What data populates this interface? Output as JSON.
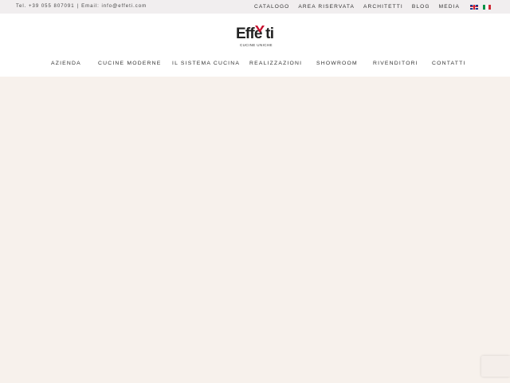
{
  "topbar": {
    "phone": "Tel. +39 055 807091",
    "separator": "|",
    "email": "Email: info@effeti.com",
    "links": [
      "CATALOGO",
      "AREA RISERVATA",
      "ARCHITETTI",
      "BLOG",
      "MEDIA"
    ],
    "languages": [
      "en",
      "it"
    ]
  },
  "logo": {
    "wordmark": "Effe ti",
    "tagline": "CUCINE UNICHE"
  },
  "nav": {
    "items": [
      "AZIENDA",
      "CUCINE MODERNE",
      "IL SISTEMA CUCINA",
      "REALIZZAZIONI",
      "SHOWROOM",
      "RIVENDITORI",
      "CONTATTI"
    ]
  },
  "colors": {
    "topbar_bg": "#f1eeef",
    "hero_bg": "#f7f1ec",
    "brand_red": "#c8102e"
  }
}
